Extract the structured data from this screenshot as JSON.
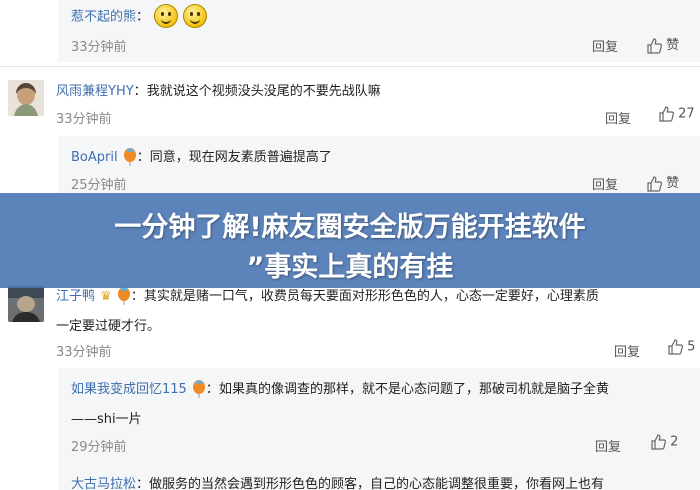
{
  "banner": {
    "line1": "一分钟了解!麻友圈安全版万能开挂软件",
    "line2": "”事实上真的有挂"
  },
  "comments": [
    {
      "user": "惹不起的熊",
      "text": "",
      "time": "33分钟前",
      "reply": "回复",
      "likes": "赞"
    },
    {
      "user": "风雨兼程YHY",
      "text": "我就说这个视频没头没尾的不要先战队嘛",
      "time": "33分钟前",
      "reply": "回复",
      "likes": "27"
    },
    {
      "user": "BoApril",
      "text": "同意，现在网友素质普遍提高了",
      "time": "25分钟前",
      "reply": "回复",
      "likes": "赞"
    },
    {
      "user": "江子鸭",
      "text": "其实就是赌一口气，收费员每天要面对形形色色的人，心态一定要好，心理素质",
      "text2": "一定要过硬才行。",
      "time": "33分钟前",
      "reply": "回复",
      "likes": "5"
    },
    {
      "user": "如果我变成回忆115",
      "text": "如果真的像调查的那样，就不是心态问题了，那破司机就是脑子全黄",
      "text2": "——shi一片",
      "time": "29分钟前",
      "reply": "回复",
      "likes": "2"
    },
    {
      "user": "大古马拉松",
      "text": "做服务的当然会遇到形形色色的顾客，自己的心态能调整很重要，你看网上也有",
      "time": "",
      "reply": "",
      "likes": ""
    }
  ],
  "icons": {
    "thumb": "thumbs-up-icon",
    "emoji": "smiley-emoji-icon",
    "badge": "balloon-badge-icon"
  },
  "colors": {
    "username": "#3f6fae",
    "banner": "#4a76b2",
    "panel": "#f5f6f7"
  }
}
